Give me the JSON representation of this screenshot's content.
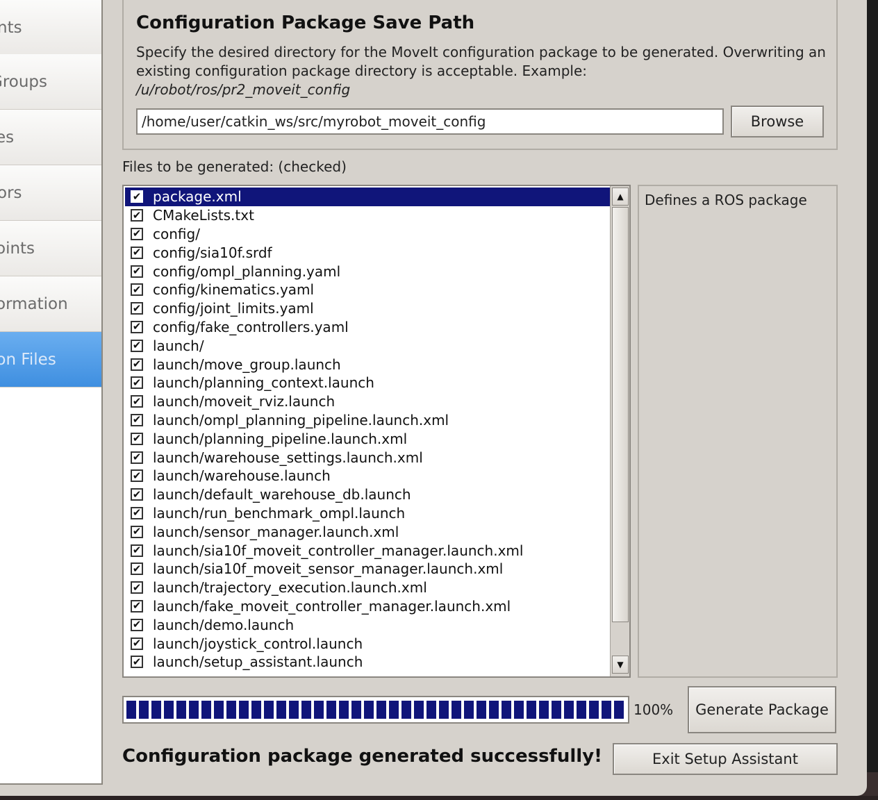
{
  "sidebar": {
    "items": [
      {
        "label": "nts",
        "active": false
      },
      {
        "label": "Groups",
        "active": false
      },
      {
        "label": "es",
        "active": false
      },
      {
        "label": "ors",
        "active": false
      },
      {
        "label": "oints",
        "active": false
      },
      {
        "label": "ormation",
        "active": false
      },
      {
        "label": "ion Files",
        "active": true
      }
    ]
  },
  "save_path": {
    "title": "Configuration Package Save Path",
    "description": "Specify the desired directory for the MoveIt configuration package to be generated. Overwriting an existing configuration package directory is acceptable. Example:",
    "example": "/u/robot/ros/pr2_moveit_config",
    "value": "/home/user/catkin_ws/src/myrobot_moveit_config",
    "browse_label": "Browse"
  },
  "files": {
    "label": "Files to be generated: (checked)",
    "items": [
      {
        "name": "package.xml",
        "checked": true,
        "selected": true
      },
      {
        "name": "CMakeLists.txt",
        "checked": true
      },
      {
        "name": "config/",
        "checked": true
      },
      {
        "name": "config/sia10f.srdf",
        "checked": true
      },
      {
        "name": "config/ompl_planning.yaml",
        "checked": true
      },
      {
        "name": "config/kinematics.yaml",
        "checked": true
      },
      {
        "name": "config/joint_limits.yaml",
        "checked": true
      },
      {
        "name": "config/fake_controllers.yaml",
        "checked": true
      },
      {
        "name": "launch/",
        "checked": true
      },
      {
        "name": "launch/move_group.launch",
        "checked": true
      },
      {
        "name": "launch/planning_context.launch",
        "checked": true
      },
      {
        "name": "launch/moveit_rviz.launch",
        "checked": true
      },
      {
        "name": "launch/ompl_planning_pipeline.launch.xml",
        "checked": true
      },
      {
        "name": "launch/planning_pipeline.launch.xml",
        "checked": true
      },
      {
        "name": "launch/warehouse_settings.launch.xml",
        "checked": true
      },
      {
        "name": "launch/warehouse.launch",
        "checked": true
      },
      {
        "name": "launch/default_warehouse_db.launch",
        "checked": true
      },
      {
        "name": "launch/run_benchmark_ompl.launch",
        "checked": true
      },
      {
        "name": "launch/sensor_manager.launch.xml",
        "checked": true
      },
      {
        "name": "launch/sia10f_moveit_controller_manager.launch.xml",
        "checked": true
      },
      {
        "name": "launch/sia10f_moveit_sensor_manager.launch.xml",
        "checked": true
      },
      {
        "name": "launch/trajectory_execution.launch.xml",
        "checked": true
      },
      {
        "name": "launch/fake_moveit_controller_manager.launch.xml",
        "checked": true
      },
      {
        "name": "launch/demo.launch",
        "checked": true
      },
      {
        "name": "launch/joystick_control.launch",
        "checked": true
      },
      {
        "name": "launch/setup_assistant.launch",
        "checked": true
      }
    ],
    "description": "Defines a ROS package"
  },
  "progress": {
    "value": 1.0,
    "text": "100%"
  },
  "buttons": {
    "generate": "Generate Package",
    "exit": "Exit Setup Assistant"
  },
  "status": "Configuration package generated successfully!",
  "colors": {
    "selection": "#10157a",
    "sidebar_active": "#4a97e6",
    "window_bg": "#d6d2cc"
  }
}
